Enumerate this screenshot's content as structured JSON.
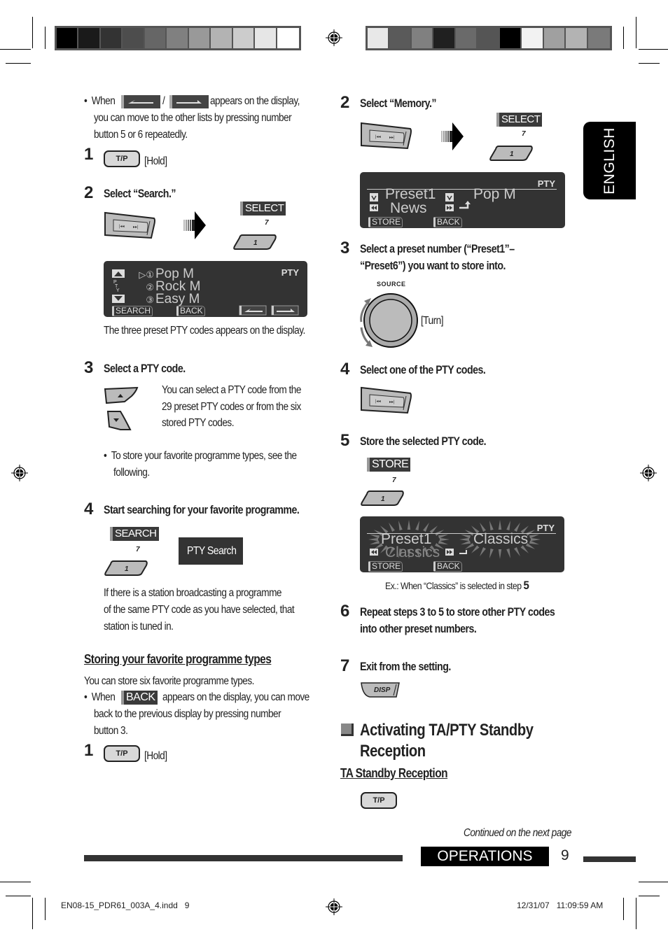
{
  "print_marks": {
    "colorbar_left": [
      "#000000",
      "#1a1a1a",
      "#333333",
      "#4d4d4d",
      "#666666",
      "#808080",
      "#999999",
      "#b3b3b3",
      "#cccccc",
      "#e6e6e6",
      "#ffffff"
    ],
    "colorbar_right": [
      "#e8e8e8",
      "#5a5a5a",
      "#808080",
      "#202020",
      "#6a6a6a",
      "#555555",
      "#000000",
      "#f2f2f2",
      "#a0a0a0",
      "#b3b3b3",
      "#7a7a7a"
    ],
    "slug_left": "EN08-15_PDR61_003A_4.indd   9",
    "slug_right": "12/31/07   11:09:59 AM"
  },
  "side_tab": {
    "label": "ENGLISH"
  },
  "left_column": {
    "intro_bullet": {
      "prefix": "When",
      "separator": "/",
      "line1_suffix": "appears on the display,",
      "line2": "you can move to the other lists by pressing number",
      "line3": "button 5 or 6 repeatedly."
    },
    "search_steps": [
      {
        "num": "1",
        "button": "T/P",
        "action": "[Hold]"
      },
      {
        "num": "2",
        "title": "Select “Search.”",
        "select_chip": "SELECT",
        "key_small": "7",
        "key_number": "1",
        "lcd": {
          "pty": "PTY",
          "rows": [
            {
              "marker": "▷①",
              "text": "Pop M"
            },
            {
              "marker": "②",
              "text": "Rock M"
            },
            {
              "marker": "③",
              "text": "Easy M"
            }
          ],
          "soft_keys": [
            "SEARCH",
            "BACK"
          ]
        },
        "caption": "The three preset PTY codes appears on the display."
      },
      {
        "num": "3",
        "title": "Select a PTY code.",
        "desc": [
          "You can select a PTY code from the",
          "29 preset PTY codes or from the six",
          "stored PTY codes."
        ],
        "bullet": [
          "To store your favorite programme types, see the",
          "following."
        ]
      },
      {
        "num": "4",
        "title": "Start searching for your favorite programme.",
        "search_chip": "SEARCH",
        "key_small": "7",
        "key_number": "1",
        "display": "PTY Search",
        "desc": [
          "If there is a station broadcasting a programme",
          "of the same PTY code as you have selected, that",
          "station is tuned in."
        ]
      }
    ],
    "storing": {
      "heading": "Storing your favorite programme types",
      "intro": "You can store six favorite programme types.",
      "bullet_prefix": "When",
      "back_chip": "BACK",
      "bullet_line1_suffix": "appears on the display, you can move",
      "bullet_line2": "back to the previous display by pressing number",
      "bullet_line3": "button 3.",
      "step1": {
        "num": "1",
        "button": "T/P",
        "action": "[Hold]"
      }
    }
  },
  "right_column": {
    "step2": {
      "num": "2",
      "title": "Select “Memory.”",
      "select_chip": "SELECT",
      "key_small": "7",
      "key_number": "1",
      "lcd": {
        "pty": "PTY",
        "preset": "Preset1",
        "current": "News",
        "target": "Pop M",
        "soft_keys": [
          "STORE",
          "BACK"
        ]
      }
    },
    "step3": {
      "num": "3",
      "title_line1": "Select a preset number (“Preset1”–",
      "title_line2": "“Preset6”) you want to store into.",
      "knob_label": "SOURCE",
      "action": "[Turn]"
    },
    "step4": {
      "num": "4",
      "title": "Select one of the PTY codes."
    },
    "step5": {
      "num": "5",
      "title": "Store the selected PTY code.",
      "store_chip": "STORE",
      "key_small": "7",
      "key_number": "1",
      "lcd": {
        "pty": "PTY",
        "preset": "Preset1",
        "current": "Classics",
        "target": "Classics",
        "soft_keys": [
          "STORE",
          "BACK"
        ]
      },
      "caption_prefix": "Ex.: When “Classics” is selected in step",
      "caption_step": "5"
    },
    "step6": {
      "num": "6",
      "title_line1": "Repeat steps 3 to 5 to store other PTY codes",
      "title_line2": "into other preset numbers."
    },
    "step7": {
      "num": "7",
      "title": "Exit from the setting.",
      "button": "DISP"
    },
    "section": {
      "title_line1": "Activating TA/PTY Standby",
      "title_line2": "Reception",
      "subheading": "TA Standby Reception",
      "button": "T/P"
    },
    "continued": "Continued on the next page"
  },
  "footer": {
    "section_label": "OPERATIONS",
    "page_number": "9"
  }
}
